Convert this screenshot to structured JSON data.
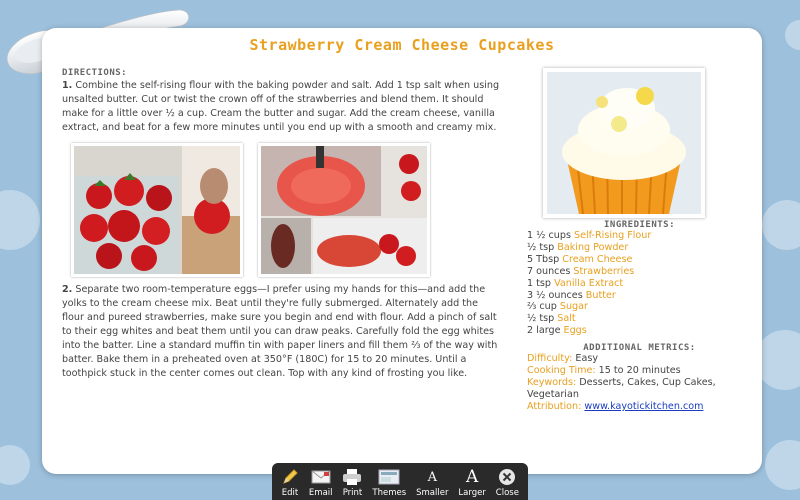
{
  "page": {
    "title": "Strawberry Cream Cheese Cupcakes",
    "colors": {
      "accent": "#e8a020",
      "background": "#9dc0dc",
      "link": "#1a3cc0"
    }
  },
  "directions": {
    "heading": "DIRECTIONS:",
    "step1_num": "1.",
    "step1": "Combine the self-rising flour with the baking powder and salt. Add 1 tsp salt when using unsalted butter. Cut or twist the crown off of the strawberries and blend them. It should make for a little over ½ a cup. Cream the butter and sugar. Add the cream cheese, vanilla extract, and beat for a few more minutes until you end up with a smooth and creamy mix.",
    "step2_num": "2.",
    "step2": "Separate two room-temperature eggs—I prefer using my hands for this—and add the yolks to the cream cheese mix. Beat until they're fully submerged. Alternately add the flour and pureed strawberries, make sure you begin and end with flour. Add a pinch of salt to their egg whites and beat them until you can draw peaks. Carefully fold the egg whites into the batter. Line a standard muffin tin with paper liners and fill them ⅔ of the way with batter. Bake them in a preheated oven at 350°F (180C) for 15 to 20 minutes. Until a toothpick stuck in the center comes out clean. Top with any kind of frosting you like."
  },
  "ingredients": {
    "heading": "INGREDIENTS:",
    "items": [
      {
        "qty": "1 ½ cups",
        "name": "Self-Rising Flour"
      },
      {
        "qty": "½ tsp",
        "name": "Baking Powder"
      },
      {
        "qty": "5 Tbsp",
        "name": "Cream Cheese"
      },
      {
        "qty": "7 ounces",
        "name": "Strawberries"
      },
      {
        "qty": "1 tsp",
        "name": "Vanilla Extract"
      },
      {
        "qty": "3 ½ ounces",
        "name": "Butter"
      },
      {
        "qty": "⅔ cup",
        "name": "Sugar"
      },
      {
        "qty": "½ tsp",
        "name": "Salt"
      },
      {
        "qty": "2 large",
        "name": "Eggs"
      }
    ]
  },
  "metrics": {
    "heading": "ADDITIONAL METRICS:",
    "difficulty_label": "Difficulty:",
    "difficulty": "Easy",
    "time_label": "Cooking Time:",
    "time": "15 to 20 minutes",
    "keywords_label": "Keywords:",
    "keywords": "Desserts, Cakes, Cup Cakes, Vegetarian",
    "attribution_label": "Attribution:",
    "attribution": "www.kayotickitchen.com"
  },
  "toolbar": {
    "items": [
      {
        "label": "Edit",
        "icon": "pencil-icon"
      },
      {
        "label": "Email",
        "icon": "envelope-icon"
      },
      {
        "label": "Print",
        "icon": "printer-icon"
      },
      {
        "label": "Themes",
        "icon": "themes-icon"
      },
      {
        "label": "Smaller",
        "icon": "font-smaller-icon"
      },
      {
        "label": "Larger",
        "icon": "font-larger-icon"
      },
      {
        "label": "Close",
        "icon": "close-icon"
      }
    ]
  }
}
